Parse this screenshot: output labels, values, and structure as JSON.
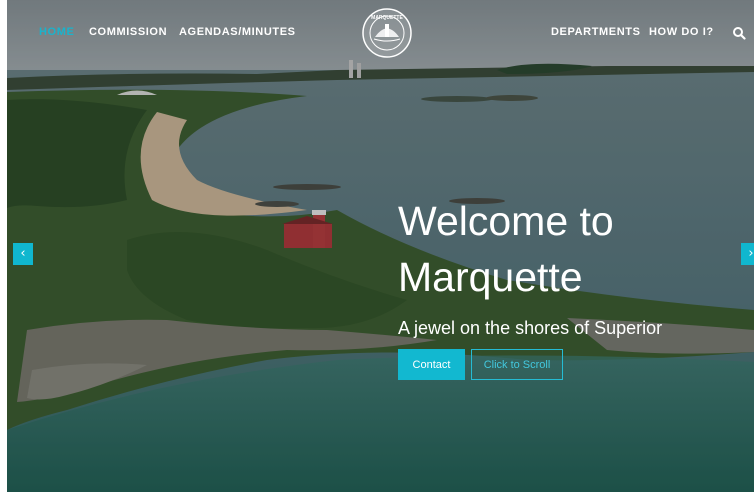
{
  "nav": {
    "left": [
      {
        "label": "HOME",
        "active": true
      },
      {
        "label": "COMMISSION",
        "active": false
      },
      {
        "label": "AGENDAS/MINUTES",
        "active": false
      }
    ],
    "right": [
      {
        "label": "DEPARTMENTS"
      },
      {
        "label": "HOW DO I?"
      }
    ],
    "search_icon": "search-icon",
    "logo_icon": "city-seal-icon",
    "logo_text": "MARQUETTE"
  },
  "hero": {
    "headline_line1": "Welcome to",
    "headline_line2": "Marquette",
    "tagline": "A jewel on the shores of Superior",
    "contact_label": "Contact",
    "scroll_label": "Click to Scroll",
    "prev_icon": "chevron-left-icon",
    "next_icon": "chevron-right-icon",
    "prev_glyph": "‹",
    "next_glyph": "›"
  },
  "colors": {
    "accent": "#12b8d0",
    "water": "#4a6d76",
    "land": "#3e5f32"
  }
}
